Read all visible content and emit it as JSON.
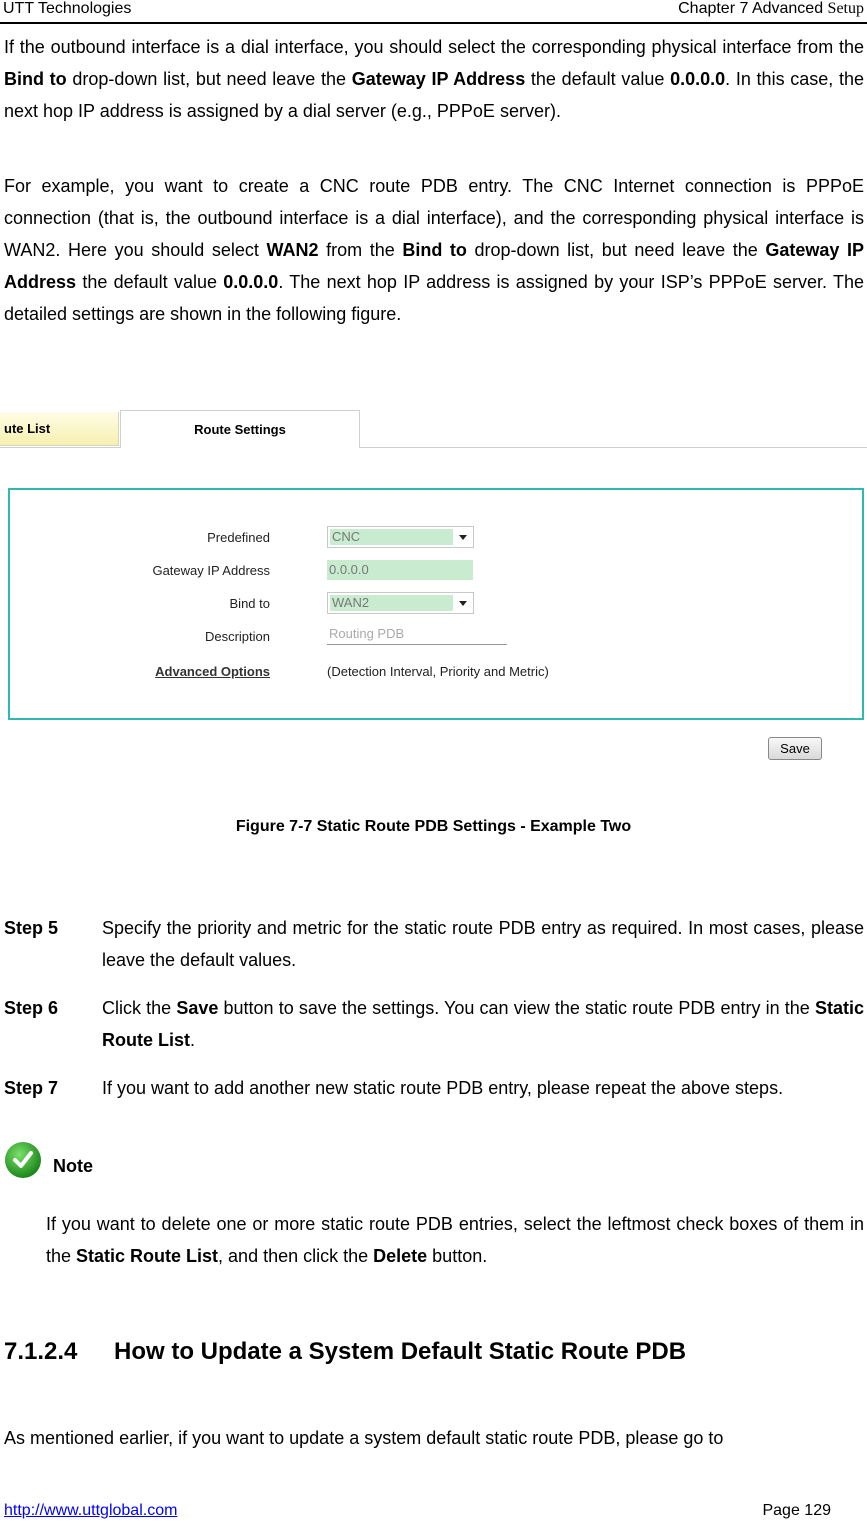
{
  "header": {
    "left": "UTT Technologies",
    "right_main": "Chapter 7 Advanced ",
    "right_serif": "Setup"
  },
  "intro": {
    "p1": [
      {
        "t": "If the outbound interface is a dial interface, you should select the corresponding physical interface from the ",
        "b": false
      },
      {
        "t": "Bind to",
        "b": true
      },
      {
        "t": " drop-down list, but need leave the ",
        "b": false
      },
      {
        "t": "Gateway IP Address",
        "b": true
      },
      {
        "t": " the default value ",
        "b": false
      },
      {
        "t": "0.0.0.0",
        "b": true
      },
      {
        "t": ". In this case, the next hop IP address is assigned by a dial server (e.g., PPPoE server).",
        "b": false
      }
    ],
    "p2": [
      {
        "t": "For example, you want to create a CNC route PDB entry. The CNC Internet connection is PPPoE connection (that is, the outbound interface is a dial interface), and the corresponding physical interface is WAN2. Here you should select ",
        "b": false
      },
      {
        "t": "WAN2",
        "b": true
      },
      {
        "t": " from the ",
        "b": false
      },
      {
        "t": "Bind to",
        "b": true
      },
      {
        "t": " drop-down list, but need leave the ",
        "b": false
      },
      {
        "t": "Gateway IP Address",
        "b": true
      },
      {
        "t": " the default value ",
        "b": false
      },
      {
        "t": "0.0.0.0",
        "b": true
      },
      {
        "t": ". The next hop IP address is assigned by your ISP’s PPPoE server. The detailed settings are shown in the following figure.",
        "b": false
      }
    ]
  },
  "figure": {
    "tabs": [
      {
        "label": "ute List",
        "active": false
      },
      {
        "label": "Route Settings",
        "active": true
      }
    ],
    "form": {
      "predefined": {
        "label": "Predefined",
        "value": "CNC"
      },
      "gateway": {
        "label": "Gateway IP Address",
        "value": "0.0.0.0"
      },
      "bind_to": {
        "label": "Bind to",
        "value": "WAN2"
      },
      "description": {
        "label": "Description",
        "placeholder": "Routing PDB"
      },
      "advanced": {
        "label": "Advanced Options",
        "hint": "(Detection Interval, Priority and Metric)"
      }
    },
    "save_label": "Save",
    "colors": {
      "panel_border": "#2fb8b0",
      "field_fill": "#c9ecd0",
      "tab_inactive": "#f6f0b0"
    },
    "caption": "Figure 7-7 Static Route PDB Settings - Example Two"
  },
  "steps": [
    {
      "key": "Step 5",
      "parts": [
        {
          "t": "Specify the priority and metric for the static route PDB entry as required. In most cases, please leave the default values.",
          "b": false
        }
      ]
    },
    {
      "key": "Step 6",
      "parts": [
        {
          "t": "Click the ",
          "b": false
        },
        {
          "t": "Save",
          "b": true
        },
        {
          "t": " button to save the settings. You can view the static route PDB entry in the ",
          "b": false
        },
        {
          "t": "Static Route List",
          "b": true
        },
        {
          "t": ".",
          "b": false
        }
      ]
    },
    {
      "key": "Step 7",
      "parts": [
        {
          "t": "If you want to add another new static route PDB entry, please repeat the above steps.",
          "b": false
        }
      ]
    }
  ],
  "note": {
    "label": "Note",
    "icon": "green-check-icon",
    "text": [
      {
        "t": "If you want to delete one or more static route PDB entries, select the leftmost check boxes of them in the ",
        "b": false
      },
      {
        "t": "Static Route List",
        "b": true
      },
      {
        "t": ", and then click the ",
        "b": false
      },
      {
        "t": "Delete",
        "b": true
      },
      {
        "t": " button.",
        "b": false
      }
    ]
  },
  "section": {
    "number": "7.1.2.4",
    "title": "How to Update a System Default Static Route PDB"
  },
  "closing": "As mentioned earlier, if you want to update a system default static route PDB, please go to",
  "footer": {
    "url": "http://www.uttglobal.com",
    "page": "Page 129"
  }
}
